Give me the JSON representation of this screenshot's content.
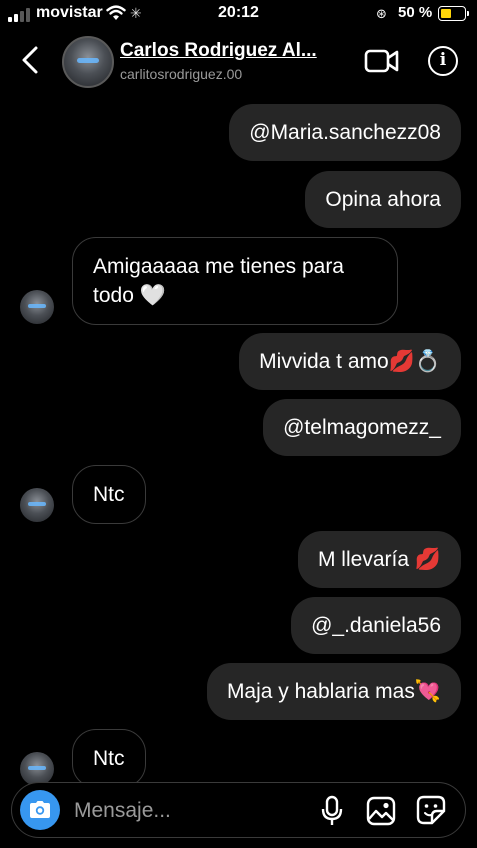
{
  "status_bar": {
    "carrier": "movistar",
    "time": "20:12",
    "battery_percent": "50 %",
    "battery_level": 0.5,
    "battery_color": "#ffd60a"
  },
  "header": {
    "contact_name": "Carlos Rodriguez Al...",
    "contact_username": "carlitosrodriguez.00",
    "back_icon": "chevron-left-icon",
    "video_icon": "video-call-icon",
    "info_icon": "info-icon",
    "info_glyph": "i"
  },
  "messages": [
    {
      "direction": "out",
      "text": "@Maria.sanchezz08"
    },
    {
      "direction": "out",
      "text": "Opina ahora"
    },
    {
      "direction": "in",
      "text": "Amigaaaaa me tienes para todo 🤍",
      "line1": "Amigaaaaa me tienes para",
      "line2": "todo 🤍"
    },
    {
      "direction": "out",
      "text": "Mivvida t amo💋💍"
    },
    {
      "direction": "out",
      "text": "@telmagomezz_"
    },
    {
      "direction": "in",
      "text": "Ntc"
    },
    {
      "direction": "out",
      "text": "M llevaría 💋"
    },
    {
      "direction": "out",
      "text": "@_.daniela56"
    },
    {
      "direction": "out",
      "text": "Maja y hablaria mas💘"
    },
    {
      "direction": "in",
      "text": "Ntc"
    }
  ],
  "composer": {
    "placeholder": "Mensaje...",
    "camera_icon": "camera-icon",
    "mic_icon": "microphone-icon",
    "gallery_icon": "gallery-icon",
    "sticker_icon": "sticker-icon"
  },
  "colors": {
    "background": "#000000",
    "bubble_out": "#262626",
    "bubble_in_border": "#3a3a3a",
    "accent": "#3797f0"
  }
}
